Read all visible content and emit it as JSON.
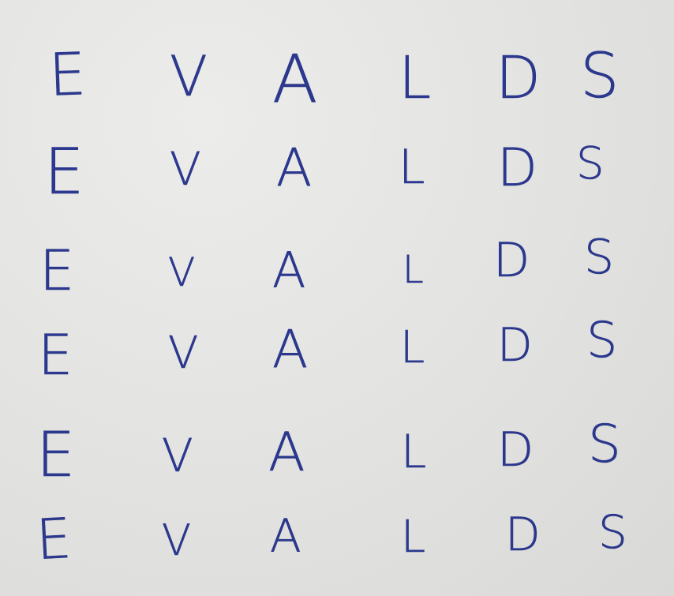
{
  "rows": [
    [
      "E",
      "V",
      "A",
      "L",
      "D",
      "S"
    ],
    [
      "E",
      "V",
      "A",
      "L",
      "D",
      "S"
    ],
    [
      "E",
      "V",
      "A",
      "L",
      "D",
      "S"
    ],
    [
      "E",
      "V",
      "A",
      "L",
      "D",
      "S"
    ],
    [
      "E",
      "V",
      "A",
      "L",
      "D",
      "S"
    ],
    [
      "E",
      "V",
      "A",
      "L",
      "D",
      "S"
    ]
  ],
  "colors": {
    "paper": "#e3e3e1",
    "ink": "#1c2a86"
  }
}
